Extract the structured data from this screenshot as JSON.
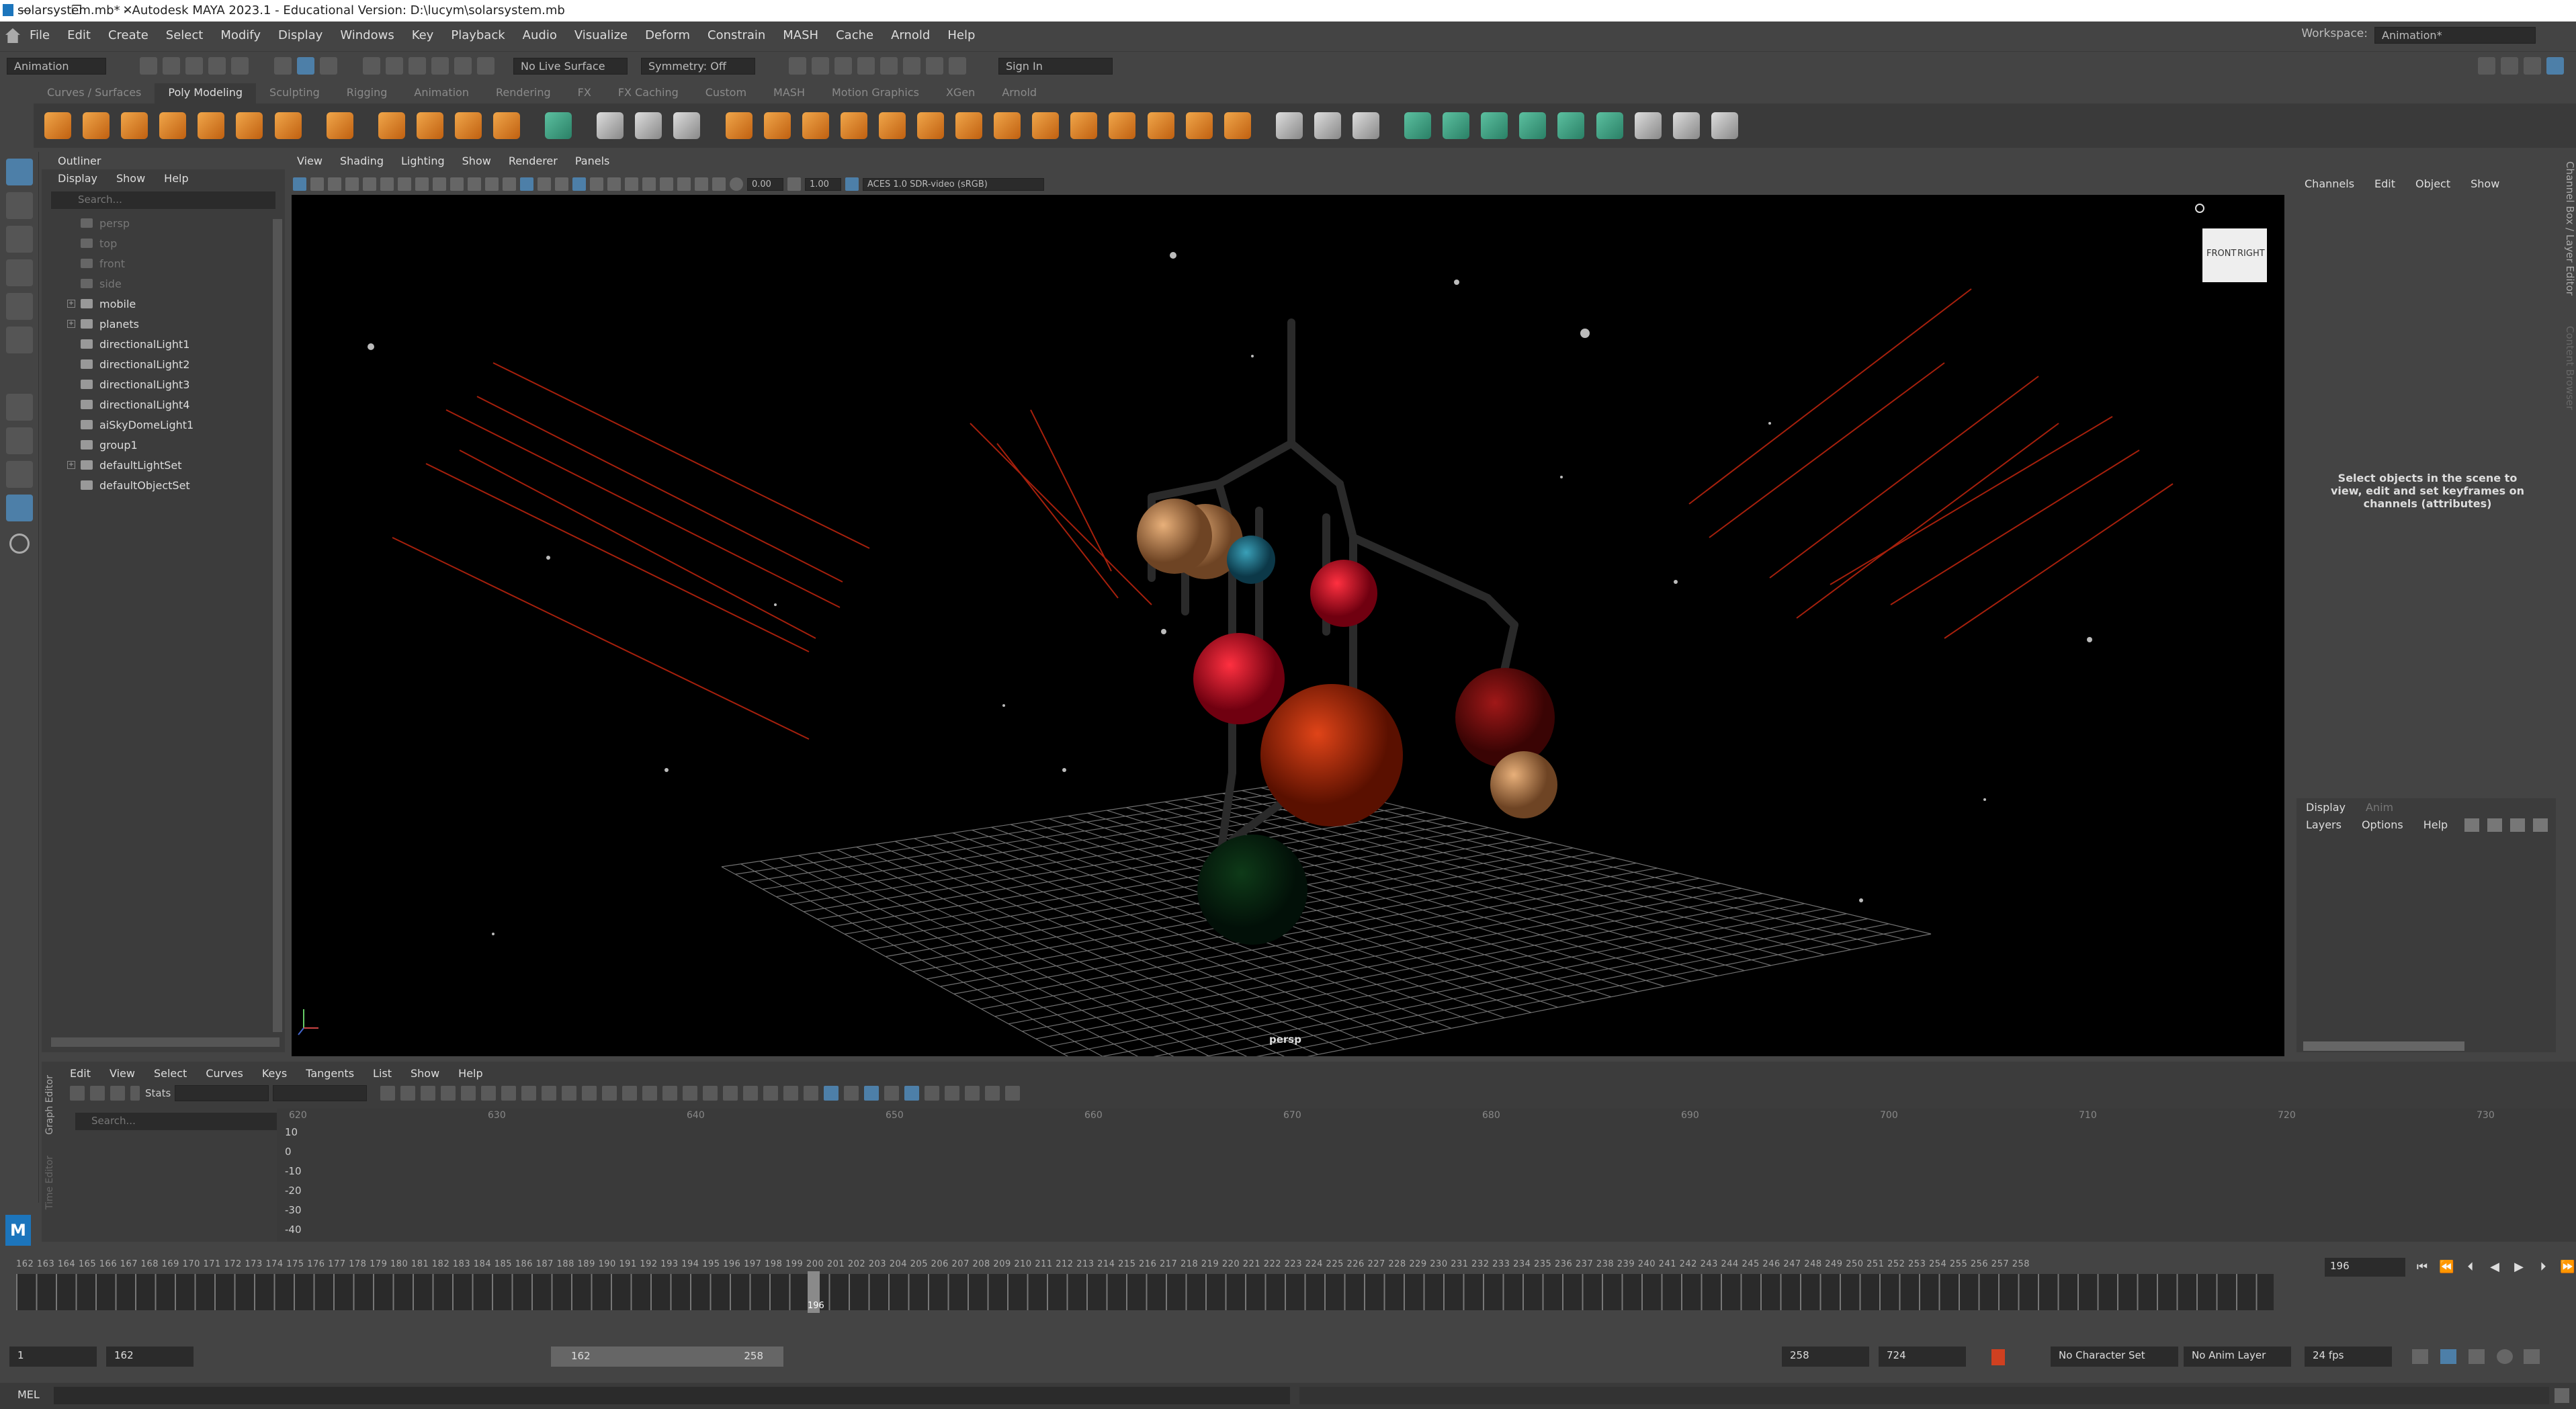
{
  "title": "solarsystem.mb* - Autodesk MAYA 2023.1 - Educational Version: D:\\lucym\\solarsystem.mb",
  "window_controls": [
    "—",
    "❐",
    "✕"
  ],
  "menus": [
    "File",
    "Edit",
    "Create",
    "Select",
    "Modify",
    "Display",
    "Windows",
    "Key",
    "Playback",
    "Audio",
    "Visualize",
    "Deform",
    "Constrain",
    "MASH",
    "Cache",
    "Arnold",
    "Help"
  ],
  "workspace": {
    "label": "Workspace:",
    "value": "Animation*"
  },
  "status": {
    "mode": "Animation",
    "live_surface": "No Live Surface",
    "symmetry": "Symmetry: Off",
    "sign_in": "Sign In"
  },
  "shelf_tabs": [
    "Curves / Surfaces",
    "Poly Modeling",
    "Sculpting",
    "Rigging",
    "Animation",
    "Rendering",
    "FX",
    "FX Caching",
    "Custom",
    "MASH",
    "Motion Graphics",
    "XGen",
    "Arnold"
  ],
  "shelf_active": "Poly Modeling",
  "outliner": {
    "title": "Outliner",
    "menus": [
      "Display",
      "Show",
      "Help"
    ],
    "search_placeholder": "Search...",
    "items": [
      {
        "label": "persp",
        "dim": true,
        "exp": ""
      },
      {
        "label": "top",
        "dim": true,
        "exp": ""
      },
      {
        "label": "front",
        "dim": true,
        "exp": ""
      },
      {
        "label": "side",
        "dim": true,
        "exp": ""
      },
      {
        "label": "mobile",
        "dim": false,
        "exp": "+"
      },
      {
        "label": "planets",
        "dim": false,
        "exp": "+"
      },
      {
        "label": "directionalLight1",
        "dim": false,
        "exp": ""
      },
      {
        "label": "directionalLight2",
        "dim": false,
        "exp": ""
      },
      {
        "label": "directionalLight3",
        "dim": false,
        "exp": ""
      },
      {
        "label": "directionalLight4",
        "dim": false,
        "exp": ""
      },
      {
        "label": "aiSkyDomeLight1",
        "dim": false,
        "exp": ""
      },
      {
        "label": "group1",
        "dim": false,
        "exp": ""
      },
      {
        "label": "defaultLightSet",
        "dim": false,
        "exp": "+"
      },
      {
        "label": "defaultObjectSet",
        "dim": false,
        "exp": ""
      }
    ]
  },
  "viewport": {
    "menus": [
      "View",
      "Shading",
      "Lighting",
      "Show",
      "Renderer",
      "Panels"
    ],
    "exposure": "0.00",
    "gamma": "1.00",
    "color_space": "ACES 1.0 SDR-video (sRGB)",
    "camera_label": "persp",
    "viewcube": {
      "front": "FRONT",
      "right": "RIGHT"
    }
  },
  "channel_box": {
    "menus": [
      "Channels",
      "Edit",
      "Object",
      "Show"
    ],
    "message": "Select objects in the scene to view, edit and set keyframes on channels (attributes)",
    "side_tabs": "Channel Box / Layer Editor",
    "side_tabs2": "Content Browser"
  },
  "layer_editor": {
    "tabs": [
      "Display",
      "Anim"
    ],
    "menus": [
      "Layers",
      "Options",
      "Help"
    ]
  },
  "graph_editor": {
    "menus": [
      "Edit",
      "View",
      "Select",
      "Curves",
      "Keys",
      "Tangents",
      "List",
      "Show",
      "Help"
    ],
    "stats_label": "Stats",
    "search_placeholder": "Search...",
    "side_label": "Graph Editor",
    "side_label2": "Time Editor",
    "ruler": [
      "620",
      "630",
      "640",
      "650",
      "660",
      "670",
      "680",
      "690",
      "700",
      "710",
      "720",
      "730"
    ],
    "y_labels": [
      "10",
      "0",
      "-10",
      "-20",
      "-30",
      "-40"
    ]
  },
  "timeline": {
    "start_tick": 162,
    "end_tick": 258,
    "current": "196",
    "current_field": "196"
  },
  "range": {
    "start": "1",
    "playback_start": "162",
    "bar_start": "162",
    "bar_end": "258",
    "playback_end": "258",
    "end": "724",
    "character_set": "No Character Set",
    "anim_layer": "No Anim Layer",
    "fps": "24 fps"
  },
  "command_line": {
    "label": "MEL"
  },
  "logo": "M"
}
